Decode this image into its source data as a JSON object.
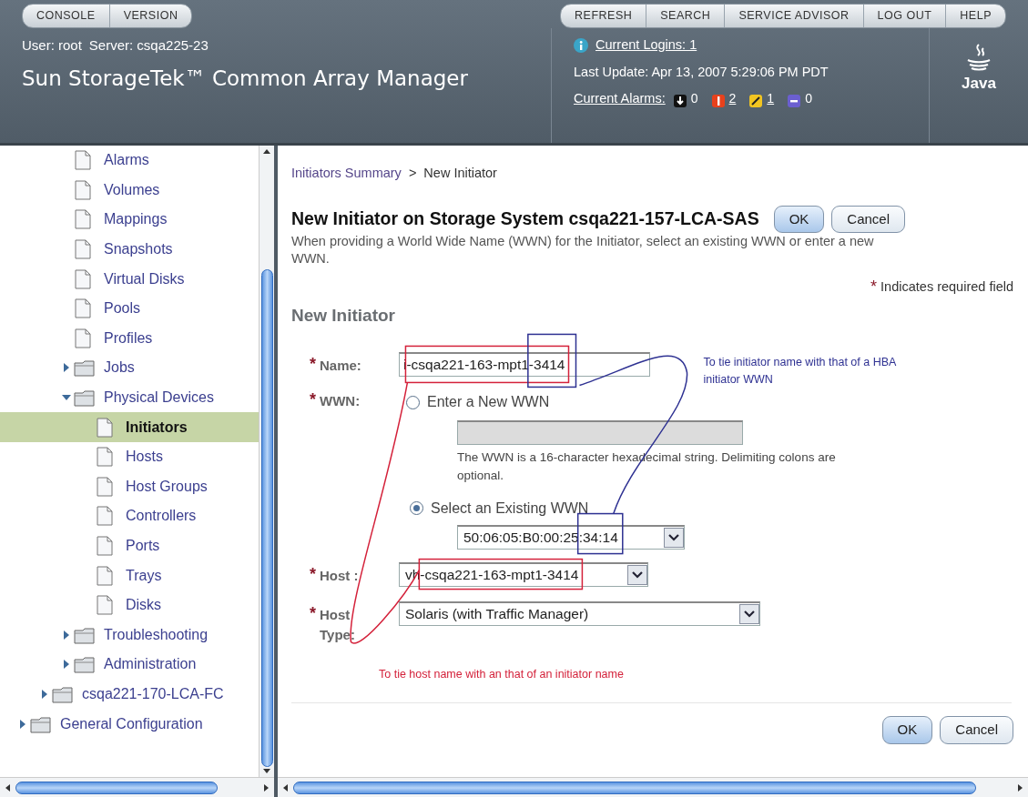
{
  "top_nav": {
    "left": [
      "CONSOLE",
      "VERSION"
    ],
    "right": [
      "REFRESH",
      "SEARCH",
      "SERVICE ADVISOR",
      "LOG OUT",
      "HELP"
    ]
  },
  "header": {
    "user": "User: root",
    "server": "Server: csqa225-23",
    "product": "Sun StorageTek™ Common Array Manager",
    "logins_link": "Current Logins: 1",
    "last_update": "Last Update: Apr 13, 2007 5:29:06 PM PDT",
    "alarms_label": "Current Alarms:",
    "alarms": [
      {
        "kind": "down",
        "count": "0",
        "color": "#111111"
      },
      {
        "kind": "critical",
        "count": "2",
        "color": "#e8411c"
      },
      {
        "kind": "major",
        "count": "1",
        "color": "#f2c521"
      },
      {
        "kind": "minor",
        "count": "0",
        "color": "#6b5fd0"
      }
    ],
    "logo_text": "Java"
  },
  "sidebar": {
    "tree": [
      {
        "children": [
          {
            "children": [
              {
                "label": "Alarms",
                "kind": "page",
                "selected": false
              },
              {
                "label": "Volumes",
                "kind": "page",
                "selected": false
              },
              {
                "label": "Mappings",
                "kind": "page",
                "selected": false
              },
              {
                "label": "Snapshots",
                "kind": "page",
                "selected": false
              },
              {
                "label": "Virtual Disks",
                "kind": "page",
                "selected": false
              },
              {
                "label": "Pools",
                "kind": "page",
                "selected": false
              },
              {
                "label": "Profiles",
                "kind": "page",
                "selected": false
              },
              {
                "label": "Jobs",
                "kind": "folder",
                "expanded": false,
                "selected": false
              },
              {
                "label": "Physical Devices",
                "kind": "folder",
                "expanded": true,
                "selected": false,
                "children": [
                  {
                    "label": "Initiators",
                    "kind": "page",
                    "selected": true
                  },
                  {
                    "label": "Hosts",
                    "kind": "page",
                    "selected": false
                  },
                  {
                    "label": "Host Groups",
                    "kind": "page",
                    "selected": false
                  },
                  {
                    "label": "Controllers",
                    "kind": "page",
                    "selected": false
                  },
                  {
                    "label": "Ports",
                    "kind": "page",
                    "selected": false
                  },
                  {
                    "label": "Trays",
                    "kind": "page",
                    "selected": false
                  },
                  {
                    "label": "Disks",
                    "kind": "page",
                    "selected": false
                  }
                ]
              },
              {
                "label": "Troubleshooting",
                "kind": "folder",
                "expanded": false,
                "selected": false
              },
              {
                "label": "Administration",
                "kind": "folder",
                "expanded": false,
                "selected": false
              }
            ]
          },
          {
            "label": "csqa221-170-LCA-FC",
            "kind": "folder",
            "expanded": false,
            "selected": false
          }
        ]
      },
      {
        "label": "General Configuration",
        "kind": "folder",
        "expanded": false,
        "selected": false
      }
    ]
  },
  "breadcrumb": {
    "link": "Initiators Summary",
    "separator": ">",
    "current": "New Initiator"
  },
  "page": {
    "title": "New Initiator on Storage System csqa221-157-LCA-SAS",
    "buttons": [
      {
        "label": "OK",
        "kind": "primary"
      },
      {
        "label": "Cancel",
        "kind": "secondary"
      }
    ],
    "description": "When providing a World Wide Name (WWN) for the Initiator, select an existing WWN or enter a new WWN.",
    "required_note": {
      "mark": "*",
      "text": "Indicates required field"
    },
    "section": "New Initiator"
  },
  "form": {
    "name": {
      "mark": "*",
      "label": "Name:",
      "value": "i-csqa221-163-mpt1-3414"
    },
    "wwn": {
      "mark": "*",
      "label": "WWN:",
      "options": [
        {
          "label": "Enter a New WWN",
          "selected": false,
          "kind": "text",
          "disabled": true,
          "help": "The WWN is a 16-character hexadecimal string. Delimiting colons are optional."
        },
        {
          "label": "Select an Existing WWN",
          "selected": true,
          "kind": "select",
          "value": "50:06:05:B0:00:25:34:14"
        }
      ]
    },
    "host": {
      "mark": "*",
      "label": "Host :",
      "value": "vh-csqa221-163-mpt1-3414"
    },
    "host_type": {
      "mark": "*",
      "label": "Host Type:",
      "value": "Solaris (with Traffic Manager)"
    }
  },
  "annotations": [
    {
      "text": "To tie initiator name with that of a HBA initiator WWN",
      "color": "#2e3192"
    },
    {
      "text": "To tie host name with an that of an initiator name",
      "color": "#d4213a"
    }
  ],
  "footer_buttons": [
    {
      "label": "OK",
      "kind": "primary"
    },
    {
      "label": "Cancel",
      "kind": "secondary"
    }
  ]
}
